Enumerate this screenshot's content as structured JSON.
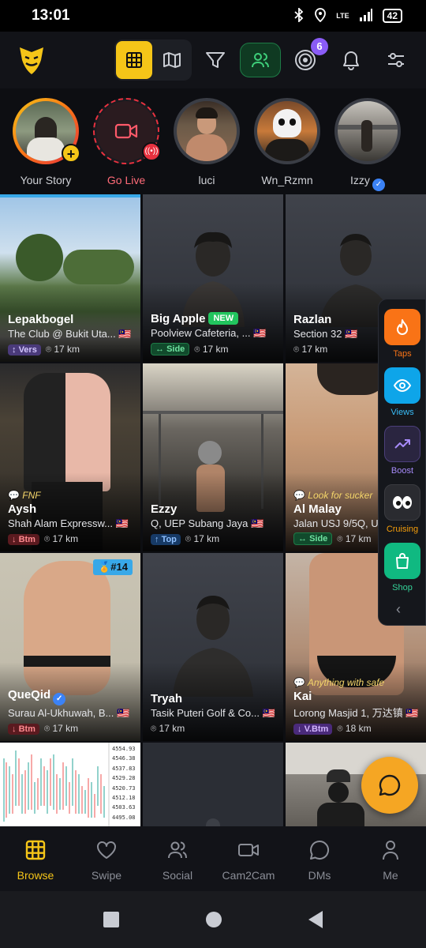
{
  "status_bar": {
    "time": "13:01",
    "battery": "42",
    "network": "LTE"
  },
  "top_nav": {
    "notifications_badge": "6"
  },
  "stories": [
    {
      "name": "Your Story"
    },
    {
      "name": "Go Live"
    },
    {
      "name": "luci"
    },
    {
      "name": "Wn_Rzmn"
    },
    {
      "name": "Izzy"
    }
  ],
  "profiles": [
    {
      "name": "Lepakbogel",
      "location": "The Club @ Bukit Uta...",
      "position": "Vers",
      "distance": "17 km"
    },
    {
      "name": "Big Apple",
      "tag": "NEW",
      "location": "Poolview Cafeteria, ...",
      "position": "Side",
      "distance": "17 km"
    },
    {
      "name": "Razlan",
      "location": "Section 32",
      "distance": "17 km"
    },
    {
      "name": "Aysh",
      "status": "FNF",
      "location": "Shah Alam Expressw...",
      "position": "Btm",
      "distance": "17 km"
    },
    {
      "name": "Ezzy",
      "location": "Q, UEP Subang Jaya",
      "position": "Top",
      "distance": "17 km"
    },
    {
      "name": "Al Malay",
      "status": "Look for sucker",
      "location": "Jalan USJ 9/5Q, U",
      "position": "Side",
      "distance": "17 km"
    },
    {
      "name": "QueQid",
      "rank": "#14",
      "location": "Surau Al-Ukhuwah, B...",
      "position": "Btm",
      "distance": "17 km"
    },
    {
      "name": "Tryah",
      "location": "Tasik Puteri Golf & Co...",
      "distance": "17 km"
    },
    {
      "name": "Kai",
      "status": "Anything with safe",
      "location": "Lorong Masjid 1, 万达镇",
      "position": "V.Btm",
      "distance": "18 km"
    }
  ],
  "chart_prices": [
    "4554.93",
    "4546.38",
    "4537.83",
    "4529.28",
    "4520.73",
    "4512.18",
    "4503.63",
    "4495.08"
  ],
  "side_panel": [
    {
      "label": "Taps",
      "color": "#f97316"
    },
    {
      "label": "Views",
      "color": "#0ea5e9"
    },
    {
      "label": "Boost",
      "color": "#8b5cf6"
    },
    {
      "label": "Cruising",
      "color": "#f59e0b"
    },
    {
      "label": "Shop",
      "color": "#10b981"
    }
  ],
  "bottom_nav": [
    {
      "label": "Browse"
    },
    {
      "label": "Swipe"
    },
    {
      "label": "Social"
    },
    {
      "label": "Cam2Cam"
    },
    {
      "label": "DMs"
    },
    {
      "label": "Me"
    }
  ]
}
